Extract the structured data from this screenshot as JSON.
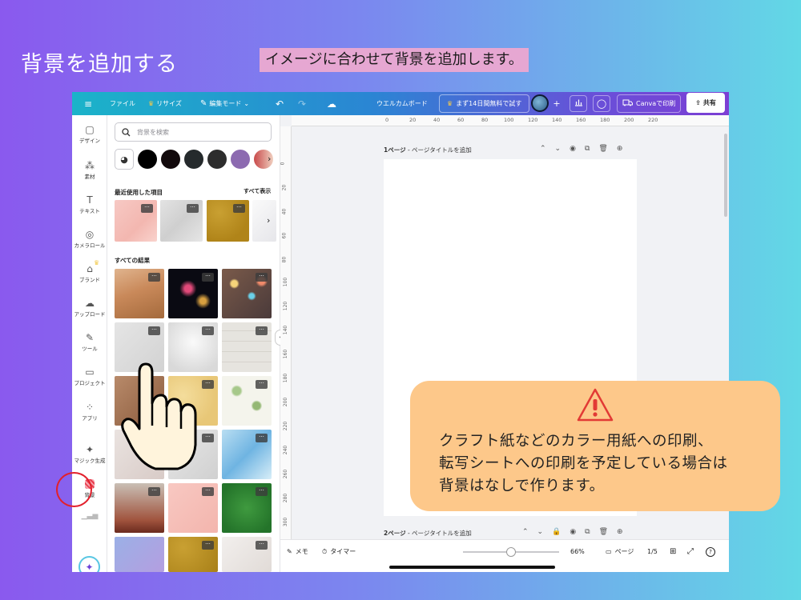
{
  "slide": {
    "title": "背景を追加する",
    "subtitle": "イメージに合わせて背景を追加します。",
    "callout": "クラフト紙などのカラー用紙への印刷、\n転写シートへの印刷を予定している場合は\n背景はなしで作ります。"
  },
  "topbar": {
    "file": "ファイル",
    "resize": "リサイズ",
    "edit_mode": "編集モード",
    "doc_title": "ウエルカムボード",
    "trial": "まず14日間無料で試す",
    "plus": "+",
    "print": "Canvaで印刷",
    "share": "共有"
  },
  "rail": {
    "items": [
      {
        "label": "デザイン",
        "icon": "▢"
      },
      {
        "label": "素材",
        "icon": "⁂"
      },
      {
        "label": "テキスト",
        "icon": "T"
      },
      {
        "label": "カメラロール",
        "icon": "◎"
      },
      {
        "label": "ブランド",
        "icon": "⌂"
      },
      {
        "label": "アップロード",
        "icon": "☁"
      },
      {
        "label": "ツール",
        "icon": "✎"
      },
      {
        "label": "プロジェクト",
        "icon": "▭"
      },
      {
        "label": "アプリ",
        "icon": "⁘"
      },
      {
        "label": "マジック生成",
        "icon": "✦"
      },
      {
        "label": "背景",
        "icon": ""
      }
    ]
  },
  "panel": {
    "search_placeholder": "背景を検索",
    "recent_title": "最近使用した項目",
    "see_all": "すべて表示",
    "all_results_title": "すべての結果",
    "swatches": [
      "#000000",
      "#120a0c",
      "#252a2c",
      "#2d2d2d",
      "#8c6ab0",
      "#c84a4a"
    ],
    "dots": "···"
  },
  "canvas": {
    "ruler_top": [
      "0",
      "20",
      "40",
      "60",
      "80",
      "100",
      "120",
      "140",
      "160",
      "180",
      "200",
      "220"
    ],
    "ruler_left": [
      "0",
      "20",
      "40",
      "60",
      "80",
      "100",
      "120",
      "140",
      "160",
      "180",
      "200",
      "220",
      "240",
      "260",
      "280",
      "300"
    ],
    "page1_num": "1ページ",
    "page1_title": " - ページタイトルを追加",
    "page2_num": "2ページ",
    "page2_title": " - ページタイトルを追加"
  },
  "bottombar": {
    "memo": "メモ",
    "timer": "タイマー",
    "zoom": "66%",
    "zoom_level": 0.5,
    "page_label": "ページ",
    "page_count": "1/5",
    "help": "?"
  }
}
